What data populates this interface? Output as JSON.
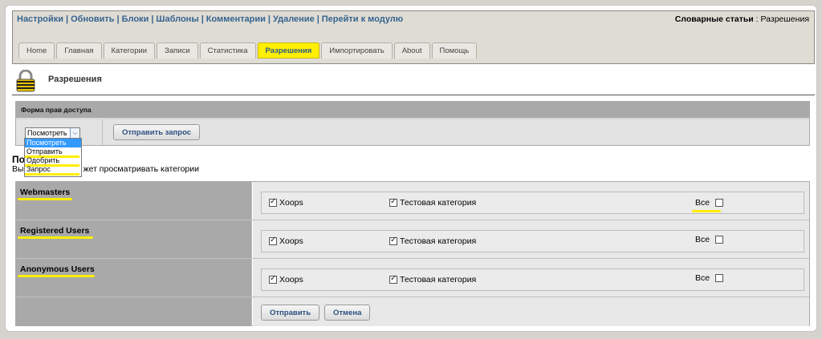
{
  "topnav": [
    "Настройки",
    "Обновить",
    "Блоки",
    "Шаблоны",
    "Комментарии",
    "Удаление",
    "Перейти к модулю"
  ],
  "module_title": {
    "bold": "Словарные статьи",
    "separator": " : ",
    "page": "Разрешения"
  },
  "tabs": [
    {
      "label": "Home",
      "active": false
    },
    {
      "label": "Главная",
      "active": false
    },
    {
      "label": "Категории",
      "active": false
    },
    {
      "label": "Записи",
      "active": false
    },
    {
      "label": "Статистика",
      "active": false
    },
    {
      "label": "Разрешения",
      "active": true
    },
    {
      "label": "Импортировать",
      "active": false
    },
    {
      "label": "About",
      "active": false
    },
    {
      "label": "Помощь",
      "active": false
    }
  ],
  "page_title": "Разрешения",
  "form": {
    "title": "Форма прав доступа",
    "selected": "Посмотреть",
    "options": [
      "Посмотреть",
      "Отправить",
      "Одобрить",
      "Запрос"
    ],
    "submit": "Отправить запрос"
  },
  "section": {
    "title_fragment": "По",
    "desc_prefix": "Вы",
    "desc_suffix": "жет просматривать категории"
  },
  "groups": [
    {
      "name": "Webmasters",
      "items": [
        "Xoops",
        "Тестовая категория"
      ],
      "all": "Все"
    },
    {
      "name": "Registered Users",
      "items": [
        "Xoops",
        "Тестовая категория"
      ],
      "all": "Все"
    },
    {
      "name": "Anonymous Users",
      "items": [
        "Xoops",
        "Тестовая категория"
      ],
      "all": "Все"
    }
  ],
  "buttons": {
    "submit": "Отправить",
    "cancel": "Отмена"
  },
  "colors": {
    "highlight": "#ffee00",
    "link": "#35638f",
    "active_tab": "#ffef00"
  }
}
